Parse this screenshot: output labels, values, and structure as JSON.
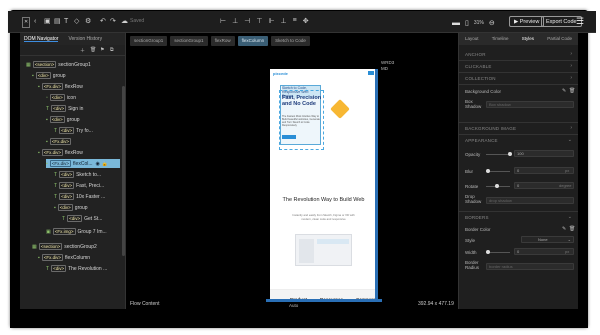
{
  "toolbar": {
    "saved": "Saved",
    "zoom": "31%",
    "preview": "▶ Preview",
    "export": "Export Code"
  },
  "left_panel": {
    "tabs": [
      "DOM Navigator",
      "Version History"
    ],
    "tree": [
      {
        "label": "<section>sectionGroup1",
        "tag": "<section>",
        "text": "sectionGroup1"
      },
      {
        "label": "<div>group",
        "tag": "<div>",
        "text": "group"
      },
      {
        "label": "<Fx.div>flexRow",
        "tag": "<Fx.div>",
        "text": "flexRow"
      },
      {
        "label": "<div>icon",
        "tag": "<div>",
        "text": "icon"
      },
      {
        "label": "<div>Sign in",
        "tag": "<div>",
        "text": "Sign in"
      },
      {
        "label": "<div>group",
        "tag": "<div>",
        "text": "group"
      },
      {
        "label": "<div>Try fo...",
        "tag": "<div>",
        "text": "Try fo..."
      },
      {
        "label": "<Fx.div>...",
        "tag": "<Fx.div>",
        "text": ""
      },
      {
        "label": "<Fx.div>flexRow",
        "tag": "<Fx.div>",
        "text": "flexRow"
      },
      {
        "label": "<Fx.div>flexCol...",
        "tag": "<Fx.div>",
        "text": "flexCol..."
      },
      {
        "label": "<div>Sketch to...",
        "tag": "<div>",
        "text": "Sketch to..."
      },
      {
        "label": "<div>Fast, Preci...",
        "tag": "<div>",
        "text": "Fast, Preci..."
      },
      {
        "label": "<div>10x Faster ...",
        "tag": "<div>",
        "text": "10x Faster ..."
      },
      {
        "label": "<div>group",
        "tag": "<div>",
        "text": "group"
      },
      {
        "label": "<div>Get St...",
        "tag": "<div>",
        "text": "Get St..."
      },
      {
        "label": "<Fx.img>Group 7 Im...",
        "tag": "<Fx.img>",
        "text": "Group 7 Im..."
      },
      {
        "label": "<section>sectionGroup2",
        "tag": "<section>",
        "text": "sectionGroup2"
      },
      {
        "label": "<Fx.div>flexColumn",
        "tag": "<Fx.div>",
        "text": "flexColumn"
      },
      {
        "label": "<div>The Revolution ...",
        "tag": "<div>",
        "text": "The Revolution ..."
      }
    ]
  },
  "canvas": {
    "breadcrumbs": [
      "sectionGroup1",
      "sectionGroup1",
      "flexRow",
      "flexColumn",
      "Sketch to Code"
    ],
    "device_label": "WRD3 MD",
    "page": {
      "logo": "pixcede",
      "hero_tag": "Sketch to Code, Responsive Web Design",
      "hero_title": "Fast, Precision and No Code",
      "hero_body": "The Fastest Most Intuitive Way to Build beautiful websites, Generate and Turn Sketch to Code Responsively",
      "section2_title": "The Revolution Way to Build Web",
      "section2_sub": "Instantly and easily from Sketch, Figma or XD with modern, clean code and responsive",
      "footer_cols": [
        "Product",
        "Resources",
        "Company"
      ]
    },
    "status_left": "Flow Content",
    "status_mid": "Auto",
    "status_right": "392.94 x 477.19"
  },
  "right_panel": {
    "tabs": [
      "Layout",
      "Timeline",
      "Styles",
      "Partial Code"
    ],
    "active_tab": "Styles",
    "sections": {
      "anchor": "ANCHOR",
      "clickable": "CLICKABLE",
      "collection": "COLLECTION",
      "background_image": "BACKGROUND IMAGE",
      "appearance": "APPEARANCE",
      "borders": "BORDERS"
    },
    "bg_color_label": "Background Color",
    "box_shadow_label": "Box Shadow",
    "box_shadow_ph": "Box shadow",
    "opacity_label": "Opacity",
    "opacity_value": "100",
    "blur_label": "Blur",
    "blur_value": "0",
    "blur_unit": "px",
    "rotate_label": "Rotate",
    "rotate_value": "0",
    "rotate_unit": "degree",
    "drop_shadow_label": "Drop Shadow",
    "drop_shadow_ph": "drop shadow",
    "border_color_label": "Border Color",
    "style_label": "Style",
    "style_value": "None",
    "width_label": "Width",
    "width_value": "0",
    "width_unit": "px",
    "border_radius_label": "Border Radius",
    "border_radius_ph": "border radius",
    "opacity_level": 1.0
  }
}
